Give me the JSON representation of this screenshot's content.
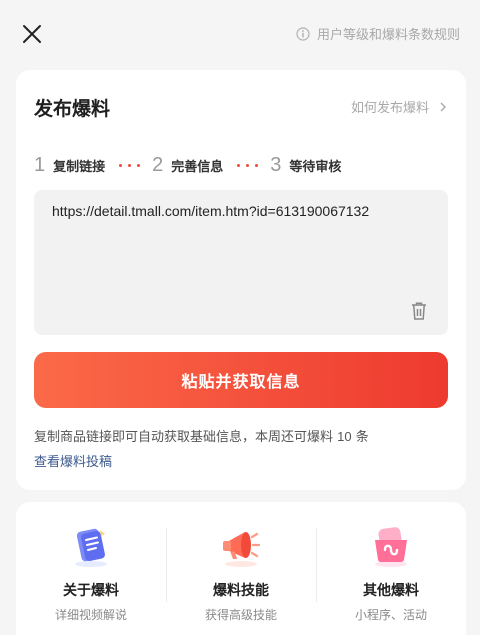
{
  "header": {
    "close_icon": "close-icon",
    "rules_icon": "info-icon",
    "rules_label": "用户等级和爆料条数规则"
  },
  "publish": {
    "title": "发布爆料",
    "how_to_label": "如何发布爆料",
    "steps": [
      {
        "number": "1",
        "label": "复制链接"
      },
      {
        "number": "2",
        "label": "完善信息"
      },
      {
        "number": "3",
        "label": "等待审核"
      }
    ],
    "url_value": "https://detail.tmall.com/item.htm?id=613190067132",
    "paste_button_label": "粘贴并获取信息",
    "hint_prefix": "复制商品链接即可自动获取基础信息，本周还可爆料",
    "hint_count": "10",
    "hint_suffix": "条",
    "my_submissions_label": "查看爆料投稿",
    "accent_color": "#ee3a30"
  },
  "features": [
    {
      "icon": "notebook-icon",
      "title": "关于爆料",
      "subtitle": "详细视频解说"
    },
    {
      "icon": "megaphone-icon",
      "title": "爆料技能",
      "subtitle": "获得高级技能"
    },
    {
      "icon": "mini-program-icon",
      "title": "其他爆料",
      "subtitle": "小程序、活动"
    }
  ]
}
